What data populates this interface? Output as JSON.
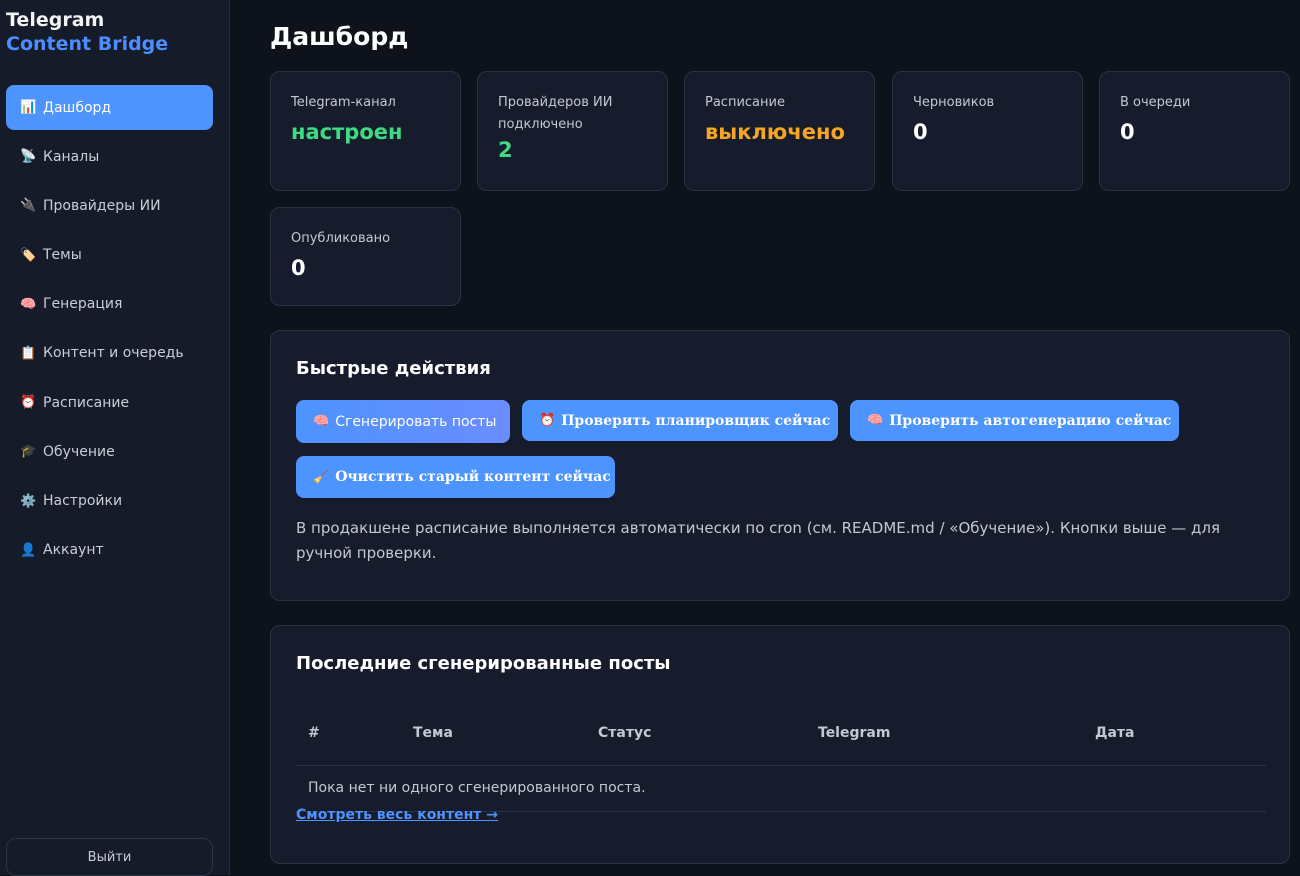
{
  "brand": {
    "line1": "Telegram",
    "line2": "Content Bridge"
  },
  "sidebar": {
    "items": [
      {
        "icon": "📊",
        "label": "Дашборд",
        "active": true
      },
      {
        "icon": "📡",
        "label": "Каналы"
      },
      {
        "icon": "🔌",
        "label": "Провайдеры ИИ"
      },
      {
        "icon": "🏷️",
        "label": "Темы"
      },
      {
        "icon": "🧠",
        "label": "Генерация"
      },
      {
        "icon": "📋",
        "label": "Контент и очередь"
      },
      {
        "icon": "⏰",
        "label": "Расписание"
      },
      {
        "icon": "🎓",
        "label": "Обучение"
      },
      {
        "icon": "⚙️",
        "label": "Настройки"
      },
      {
        "icon": "👤",
        "label": "Аккаунт"
      }
    ],
    "logout": "Выйти"
  },
  "page": {
    "title": "Дашборд"
  },
  "stats": [
    {
      "label": "Telegram-канал",
      "value": "настроен",
      "color": "#3ddc84"
    },
    {
      "label": "Провайдеров ИИ подключено",
      "value": "2",
      "color": "#3ddc84"
    },
    {
      "label": "Расписание",
      "value": "выключено",
      "color": "#f5a524"
    },
    {
      "label": "Черновиков",
      "value": "0",
      "color": "#ffffff"
    },
    {
      "label": "В очереди",
      "value": "0",
      "color": "#ffffff"
    },
    {
      "label": "Опубликовано",
      "value": "0",
      "color": "#ffffff"
    }
  ],
  "quick": {
    "title": "Быстрые действия",
    "buttons": [
      {
        "icon": "🧠",
        "label": "Сгенерировать посты"
      },
      {
        "icon": "⏰",
        "label": "Проверить планировщик сейчас"
      },
      {
        "icon": "🧠",
        "label": "Проверить автогенерацию сейчас"
      },
      {
        "icon": "🧹",
        "label": "Очистить старый контент сейчас"
      }
    ],
    "note": "В продакшене расписание выполняется автоматически по cron (см. README.md / «Обучение»). Кнопки выше — для ручной проверки."
  },
  "recent": {
    "title": "Последние сгенерированные посты",
    "columns": [
      "#",
      "Тема",
      "Статус",
      "Telegram",
      "Дата"
    ],
    "empty": "Пока нет ни одного сгенерированного поста.",
    "link": "Смотреть весь контент →"
  }
}
